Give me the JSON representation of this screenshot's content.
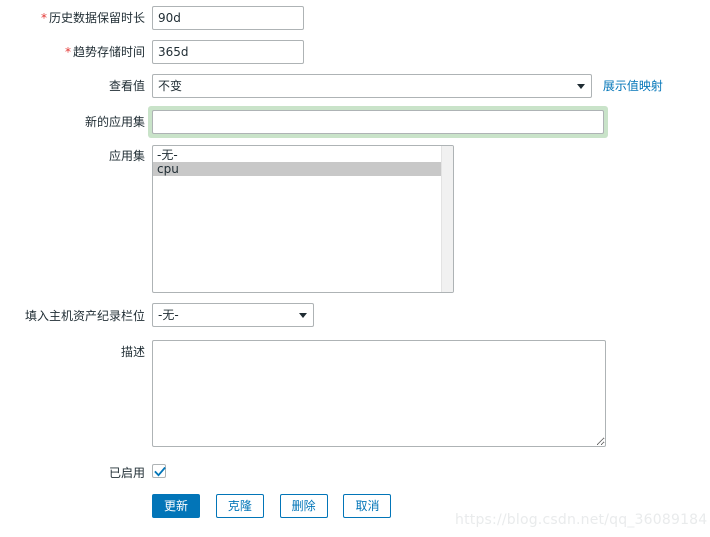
{
  "form": {
    "fields": {
      "history": {
        "label": "历史数据保留时长",
        "required": true,
        "value": "90d"
      },
      "trends": {
        "label": "趋势存储时间",
        "required": true,
        "value": "365d"
      },
      "value_type": {
        "label": "查看值",
        "required": false,
        "value": "不变",
        "options": [
          "不变"
        ],
        "link_label": "展示值映射"
      },
      "new_application": {
        "label": "新的应用集",
        "required": false,
        "value": "",
        "focused": true
      },
      "applications": {
        "label": "应用集",
        "options": [
          {
            "label": "-无-",
            "selected": false
          },
          {
            "label": "cpu",
            "selected": true
          }
        ]
      },
      "inventory_link": {
        "label": "填入主机资产纪录栏位",
        "value": "-无-",
        "options": [
          "-无-"
        ]
      },
      "description": {
        "label": "描述",
        "value": ""
      },
      "enabled": {
        "label": "已启用",
        "checked": true
      }
    },
    "buttons": {
      "update": "更新",
      "clone": "克隆",
      "delete": "删除",
      "cancel": "取消"
    }
  },
  "watermark": "https://blog.csdn.net/qq_36089184",
  "colors": {
    "accent": "#0275b8",
    "required": "#e33734",
    "focus_ring": "#c9e3c9",
    "list_selected": "#c8c8c8",
    "watermark": "#e9ebec"
  }
}
